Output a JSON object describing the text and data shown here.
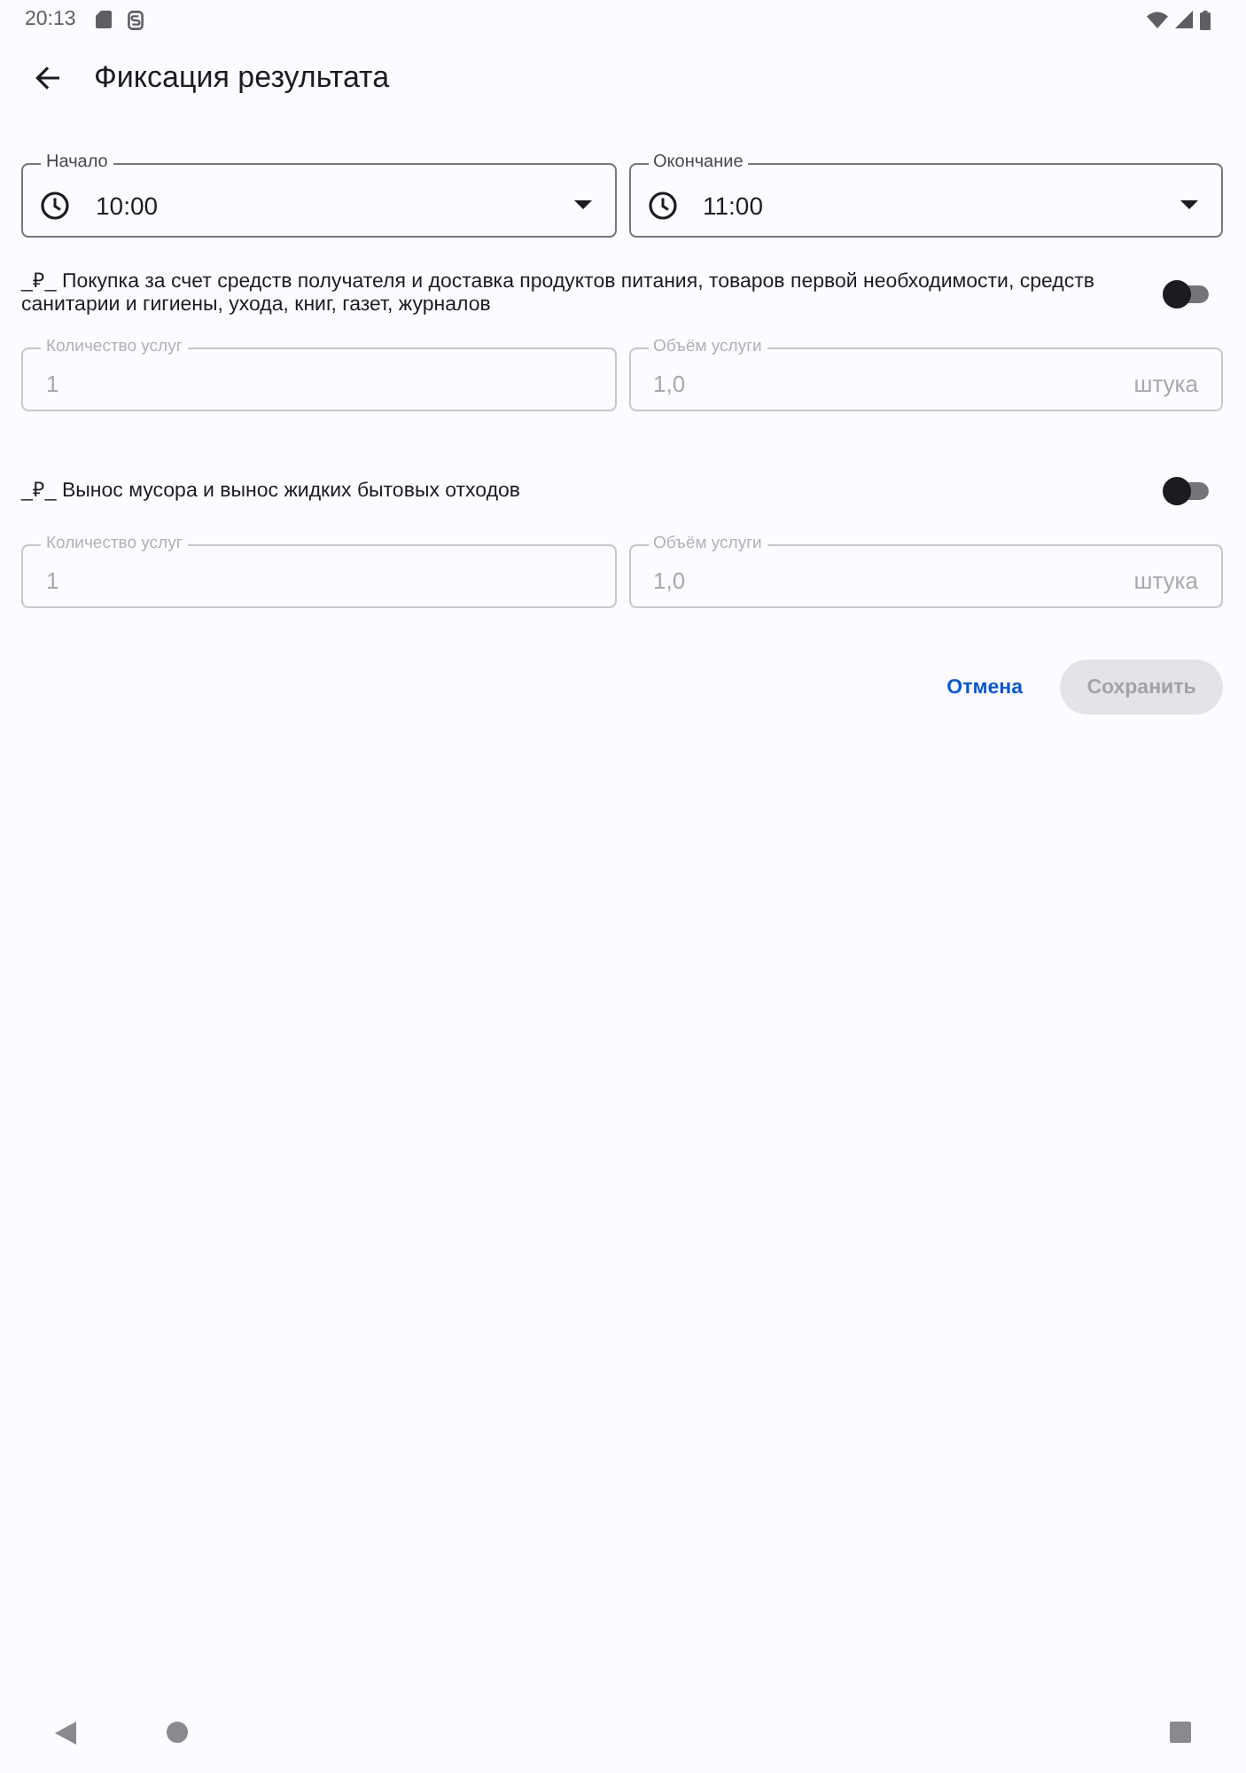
{
  "status_bar": {
    "time": "20:13"
  },
  "app_bar": {
    "title": "Фиксация результата"
  },
  "time_fields": [
    {
      "label": "Начало",
      "value": "10:00"
    },
    {
      "label": "Окончание",
      "value": "11:00"
    }
  ],
  "services": [
    {
      "title": "_₽_ Покупка за счет средств получателя и доставка продуктов питания, товаров первой необходимости, средств санитарии и гигиены, ухода, книг, газет, журналов",
      "on": false,
      "fields": [
        {
          "label": "Количество услуг",
          "value": "1",
          "disabled": true
        },
        {
          "label": "Объём услуги",
          "value": "1,0",
          "unit": "штука",
          "disabled": true
        }
      ]
    },
    {
      "title": "_₽_ Вынос мусора и вынос жидких бытовых отходов",
      "on": false,
      "fields": [
        {
          "label": "Количество услуг",
          "value": "1",
          "disabled": true
        },
        {
          "label": "Объём услуги",
          "value": "1,0",
          "unit": "штука",
          "disabled": true
        }
      ]
    }
  ],
  "actions": [
    {
      "kind": "text",
      "label": "Отмена",
      "disabled": false
    },
    {
      "kind": "filled",
      "label": "Сохранить",
      "disabled": true
    }
  ]
}
